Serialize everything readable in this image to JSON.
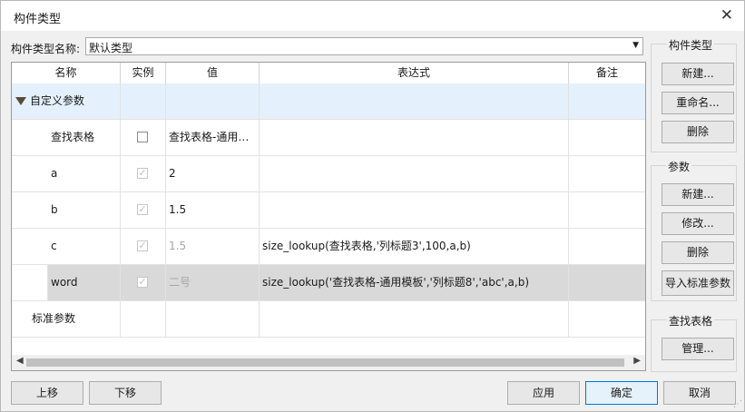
{
  "dialog": {
    "title": "构件类型"
  },
  "type_selector": {
    "label": "构件类型名称:",
    "value": "默认类型"
  },
  "table": {
    "columns": [
      "名称",
      "实例",
      "值",
      "表达式",
      "备注"
    ],
    "group_label": "自定义参数",
    "rows": [
      {
        "name": "查找表格",
        "instance": false,
        "value": "查找表格-通用…",
        "expression": "",
        "note": ""
      },
      {
        "name": "a",
        "instance": true,
        "value": "2",
        "expression": "",
        "note": ""
      },
      {
        "name": "b",
        "instance": true,
        "value": "1.5",
        "expression": "",
        "note": ""
      },
      {
        "name": "c",
        "instance": true,
        "value": "1.5",
        "expression": "size_lookup(查找表格,'列标题3',100,a,b)",
        "note": ""
      },
      {
        "name": "word",
        "instance": true,
        "value": "二号",
        "expression": "size_lookup('查找表格-通用模板','列标题8','abc',a,b)",
        "note": ""
      }
    ],
    "standard_label": "标准参数"
  },
  "panels": {
    "component_type": {
      "title": "构件类型",
      "new": "新建...",
      "rename": "重命名...",
      "delete": "删除"
    },
    "params": {
      "title": "参数",
      "new": "新建...",
      "edit": "修改...",
      "delete": "删除",
      "import": "导入标准参数"
    },
    "lookup": {
      "title": "查找表格",
      "manage": "管理..."
    }
  },
  "footer": {
    "up": "上移",
    "down": "下移",
    "apply": "应用",
    "ok": "确定",
    "cancel": "取消"
  }
}
